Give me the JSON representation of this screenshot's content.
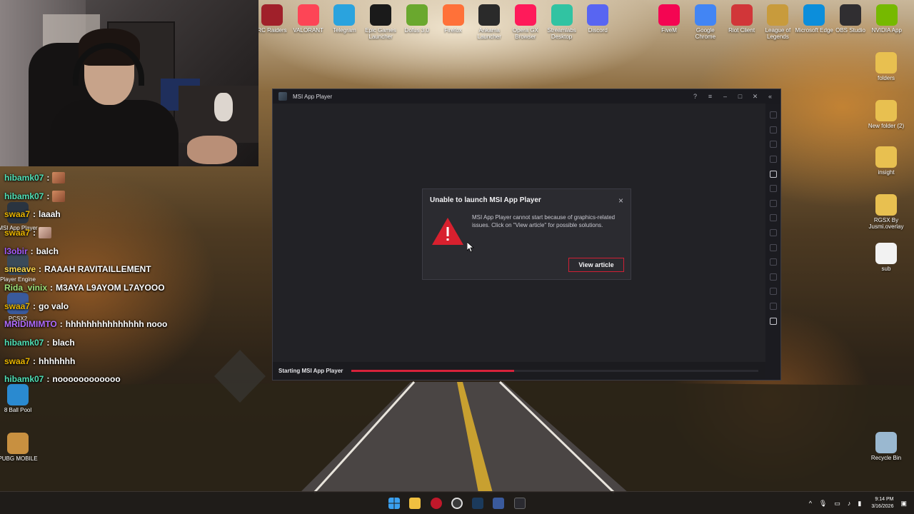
{
  "desktop": {
    "top_icons": [
      {
        "label": "RC Raiders",
        "icon": "rc-raiders-icon",
        "color": "#a0202a"
      },
      {
        "label": "VALORANT",
        "icon": "valorant-icon",
        "color": "#fd4556"
      },
      {
        "label": "Telegram",
        "icon": "telegram-icon",
        "color": "#2aa3de"
      },
      {
        "label": "Epic Games Launcher",
        "icon": "epic-games-icon",
        "color": "#1a1a1a"
      },
      {
        "label": "Dofus 3.0",
        "icon": "dofus-icon",
        "color": "#6aa82e"
      },
      {
        "label": "Firefox",
        "icon": "firefox-icon",
        "color": "#ff7139"
      },
      {
        "label": "Ankama Launcher",
        "icon": "ankama-icon",
        "color": "#2a2a2a"
      },
      {
        "label": "Opera GX Browser",
        "icon": "opera-gx-icon",
        "color": "#ff1a5a"
      },
      {
        "label": "Streamlabs Desktop",
        "icon": "streamlabs-icon",
        "color": "#31c3a2"
      },
      {
        "label": "Discord",
        "icon": "discord-icon",
        "color": "#5865f2"
      }
    ],
    "right_top_icons": [
      {
        "label": "FiveM",
        "icon": "fivem-icon",
        "color": "#f40552"
      },
      {
        "label": "Google Chrome",
        "icon": "chrome-icon",
        "color": "#4285f4"
      },
      {
        "label": "Riot Client",
        "icon": "riot-client-icon",
        "color": "#d13639"
      },
      {
        "label": "League of Legends",
        "icon": "league-of-legends-icon",
        "color": "#c89b3c"
      },
      {
        "label": "Microsoft Edge",
        "icon": "edge-icon",
        "color": "#0c8edb"
      },
      {
        "label": "OBS Studio",
        "icon": "obs-icon",
        "color": "#302e31"
      },
      {
        "label": "NVIDIA App",
        "icon": "nvidia-icon",
        "color": "#76b900"
      }
    ],
    "right_column_icons": [
      {
        "label": "folders",
        "icon": "folder-icon"
      },
      {
        "label": "New folder (2)",
        "icon": "folder-icon"
      },
      {
        "label": "insight",
        "icon": "folder-icon"
      },
      {
        "label": "RGSX By Jusmi.overlay",
        "icon": "folder-icon"
      },
      {
        "label": "sub",
        "icon": "file-icon"
      },
      {
        "label": "Recycle Bin",
        "icon": "recycle-bin-icon"
      }
    ],
    "left_icons": [
      {
        "label": "MSI App Player",
        "icon": "msi-app-player-icon"
      },
      {
        "label": "Player Engine",
        "icon": "player-engine-icon"
      },
      {
        "label": "PCSX2",
        "icon": "pcsx2-icon"
      },
      {
        "label": "8 Ball Pool",
        "icon": "8-ball-pool-icon"
      },
      {
        "label": "PUBG MOBILE",
        "icon": "pubg-mobile-icon"
      }
    ]
  },
  "chat": [
    {
      "user": "hibamk07",
      "color": "#4fe0b6",
      "message": "",
      "emote": "face"
    },
    {
      "user": "hibamk07",
      "color": "#4fe0b6",
      "message": "",
      "emote": "face"
    },
    {
      "user": "swaa7",
      "color": "#e8b400",
      "message": "laaah",
      "emote": ""
    },
    {
      "user": "swaa7",
      "color": "#e8b400",
      "message": "",
      "emote": "cat"
    },
    {
      "user": "l3obir",
      "color": "#a05cff",
      "message": "balch",
      "emote": ""
    },
    {
      "user": "smeave",
      "color": "#ffd84a",
      "message": "RAAAH RAVITAILLEMENT",
      "emote": ""
    },
    {
      "user": "Rida_vinix",
      "color": "#9de27a",
      "message": "M3AYA L9AYOM L7AYOOO",
      "emote": ""
    },
    {
      "user": "swaa7",
      "color": "#e8b400",
      "message": "go valo",
      "emote": ""
    },
    {
      "user": "MRIDIMIMTO",
      "color": "#b06cff",
      "message": "hhhhhhhhhhhhhhh nooo",
      "emote": ""
    },
    {
      "user": "hibamk07",
      "color": "#4fe0b6",
      "message": "blach",
      "emote": ""
    },
    {
      "user": "swaa7",
      "color": "#e8b400",
      "message": "hhhhhhh",
      "emote": ""
    },
    {
      "user": "hibamk07",
      "color": "#4fe0b6",
      "message": "noooooooooooo",
      "emote": ""
    }
  ],
  "msi_window": {
    "title": "MSI App Player",
    "status_text": "Starting MSI App Player",
    "progress": 0.4,
    "accent": "#d6223a"
  },
  "dialog": {
    "title": "Unable to launch MSI App Player",
    "message": "MSI App Player cannot start because of graphics-related issues. Click on \"View article\" for possible solutions.",
    "button_label": "View article",
    "close_glyph": "×",
    "warning_color": "#d8202e"
  },
  "taskbar": {
    "time": "9:14 PM",
    "date": "3/16/2026",
    "tray_arrow": "^"
  }
}
